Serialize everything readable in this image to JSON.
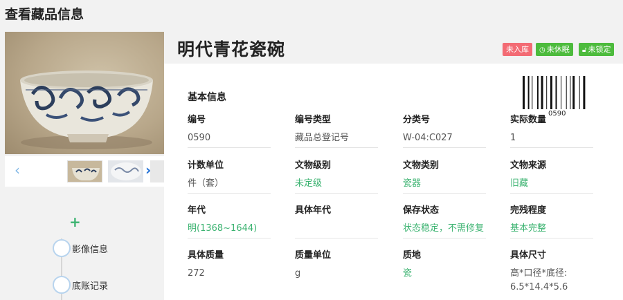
{
  "page": {
    "title": "查看藏品信息"
  },
  "gallery": {
    "prev_arrow": "‹",
    "next_arrow": "›"
  },
  "sidebar": {
    "add_icon": "+",
    "items": [
      {
        "label": "影像信息"
      },
      {
        "label": "底账记录"
      }
    ]
  },
  "item": {
    "title": "明代青花瓷碗",
    "badges": [
      {
        "label": "未入库",
        "color": "#f36b74"
      },
      {
        "label": "未休眠",
        "icon": "clock-icon",
        "color": "#4dbb3d"
      },
      {
        "label": "未锁定",
        "icon": "lock-icon",
        "color": "#4dbb3d"
      }
    ],
    "barcode_number": "0590"
  },
  "basic_info": {
    "section_title": "基本信息",
    "fields": [
      {
        "label": "编号",
        "value": "0590"
      },
      {
        "label": "编号类型",
        "value": "藏品总登记号"
      },
      {
        "label": "分类号",
        "value": "W-04:C027"
      },
      {
        "label": "实际数量",
        "value": "1"
      },
      {
        "label": "计数单位",
        "value": "件（套）"
      },
      {
        "label": "文物级别",
        "value": "未定级"
      },
      {
        "label": "文物类别",
        "value": "瓷器"
      },
      {
        "label": "文物来源",
        "value": "旧藏"
      },
      {
        "label": "年代",
        "value": "明(1368~1644)"
      },
      {
        "label": "具体年代",
        "value": ""
      },
      {
        "label": "保存状态",
        "value": "状态稳定，不需修复"
      },
      {
        "label": "完残程度",
        "value": "基本完整"
      },
      {
        "label": "具体质量",
        "value": "272"
      },
      {
        "label": "质量单位",
        "value": "g"
      },
      {
        "label": "质地",
        "value": "瓷"
      },
      {
        "label": "具体尺寸",
        "value": "高*口径*底径: 6.5*14.4*5.6"
      }
    ]
  }
}
